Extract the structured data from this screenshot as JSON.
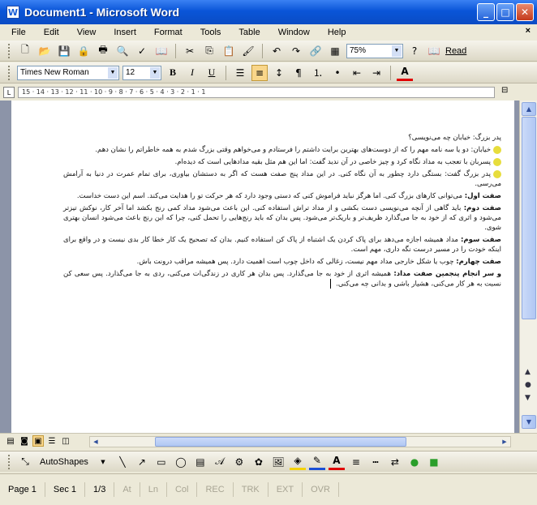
{
  "window": {
    "title": "Document1 - Microsoft Word",
    "app_icon": "W",
    "buttons": {
      "minimize": "_",
      "maximize": "□",
      "close": "✕"
    }
  },
  "menu": {
    "items": [
      "File",
      "Edit",
      "View",
      "Insert",
      "Format",
      "Tools",
      "Table",
      "Window",
      "Help"
    ],
    "close_glyph": "×"
  },
  "standard_toolbar": {
    "zoom": "75%",
    "read_label": "Read"
  },
  "formatting_toolbar": {
    "font": "Times New Roman",
    "size": "12",
    "bold": "B",
    "italic": "I",
    "underline": "U",
    "font_color_label": "A"
  },
  "ruler": {
    "text": "15 · 14 · 13 · 12 · 11 · 10 · 9 · 8 · 7 · 6 · 5 · 4 · 3 · 2 · 1 · 1"
  },
  "document": {
    "paragraphs": [
      {
        "heading": "",
        "text": "پدر بزرگ: خیابان چه می‌نویسی؟",
        "bullet": false
      },
      {
        "heading": "",
        "text": "خیابان: دو یا سه نامه مهم را که از دوست‌های بهترین برایت داشتم را فرستادم و می‌خواهم وقتی بزرگ شدم به همه خاطراتم را نشان دهم.",
        "bullet": true
      },
      {
        "heading": "",
        "text": "پسربان با تعجب به مداد نگاه کرد و چیز خاصی در آن ندید گفت: اما این هم مثل بقیه مدادهایی است که دیده‌ام.",
        "bullet": true
      },
      {
        "heading": "",
        "text": "پدر بزرگ گفت: بستگی دارد چطور به آن نگاه کنی. در این مداد پنج صفت هست که اگر به دستشان بیاوری، برای تمام عمرت در دنیا به آرامش می‌رسی.",
        "bullet": true
      },
      {
        "heading": "صفت اول:",
        "text": "می‌توانی کارهای بزرگ کنی. اما هرگز نباید فراموش کنی که دستی وجود دارد که هر حرکت تو را هدایت می‌کند. اسم این دست خداست.",
        "bullet": false
      },
      {
        "heading": "صفت دوم:",
        "text": "باید گاهی از آنچه می‌نویسی دست بکشی و از مداد تراش استفاده کنی. این باعث می‌شود مداد کمی رنج بکشد اما آخر کار، نوکش تیزتر می‌شود و اثری که از خود به جا می‌گذارد ظریف‌تر و باریک‌تر می‌شود. پس بدان که باید رنج‌هایی را تحمل کنی، چرا که این رنج باعث می‌شود انسان بهتری شوی.",
        "bullet": false
      },
      {
        "heading": "صفت سوم:",
        "text": "مداد همیشه اجازه می‌دهد برای پاک کردن یک اشتباه از پاک کن استفاده کنیم. بدان که تصحیح یک کار خطا کار بدی نیست و در واقع برای اینکه خودت را در مسیر درست نگه داری، مهم است.",
        "bullet": false
      },
      {
        "heading": "صفت چهارم:",
        "text": "چوب یا شکل خارجی مداد مهم نیست، زغالی که داخل چوب است اهمیت دارد. پس همیشه مراقب درونت باش.",
        "bullet": false
      },
      {
        "heading": "و سر انجام پنجمین صفت مداد:",
        "text": "همیشه اثری از خود به جا می‌گذارد. پس بدان هر کاری در زندگی‌ات می‌کنی، ردی به جا می‌گذارد. پس سعی کن نسبت به هر کار می‌کنی، هشیار باشی و بدانی چه می‌کنی.",
        "bullet": false
      }
    ]
  },
  "drawing_toolbar": {
    "autoshapes": "AutoShapes"
  },
  "status": {
    "page": "Page 1",
    "sec": "Sec 1",
    "pages": "1/3",
    "at": "At",
    "ln": "Ln",
    "col": "Col",
    "rec": "REC",
    "trk": "TRK",
    "ext": "EXT",
    "ovr": "OVR"
  }
}
